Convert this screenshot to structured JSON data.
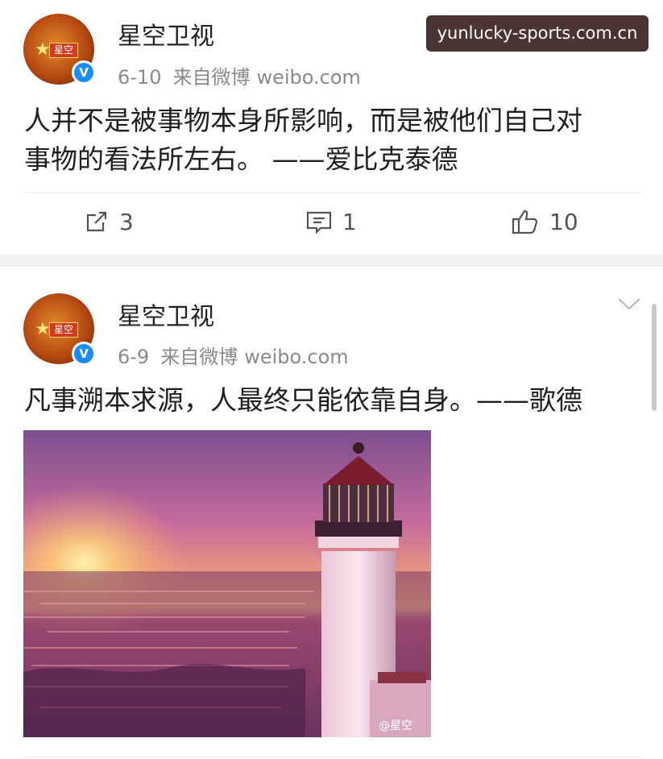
{
  "watermark": "yunlucky-sports.com.cn",
  "posts": [
    {
      "author": "星空卫视",
      "avatar_text": "星空",
      "date": "6-10",
      "source": "来自微博",
      "domain": "weibo.com",
      "text_line1": "人并不是被事物本身所影响，而是被他们自己对",
      "text_line2": "事物的看法所左右。 ——爱比克泰德",
      "reposts": "3",
      "comments": "1",
      "likes": "10"
    },
    {
      "author": "星空卫视",
      "avatar_text": "星空",
      "date": "6-9",
      "source": "来自微博",
      "domain": "weibo.com",
      "text": "凡事溯本求源，人最终只能依靠自身。——歌德",
      "image_watermark": "@星空"
    }
  ],
  "icons": {
    "verified": "verified-v-icon",
    "repost": "repost-icon",
    "comment": "comment-icon",
    "like": "thumbs-up-icon",
    "more": "chevron-down-icon"
  },
  "colors": {
    "verified_badge": "#1a8cff",
    "meta_text": "#8a8a8a",
    "separator": "#f1f1f3"
  }
}
